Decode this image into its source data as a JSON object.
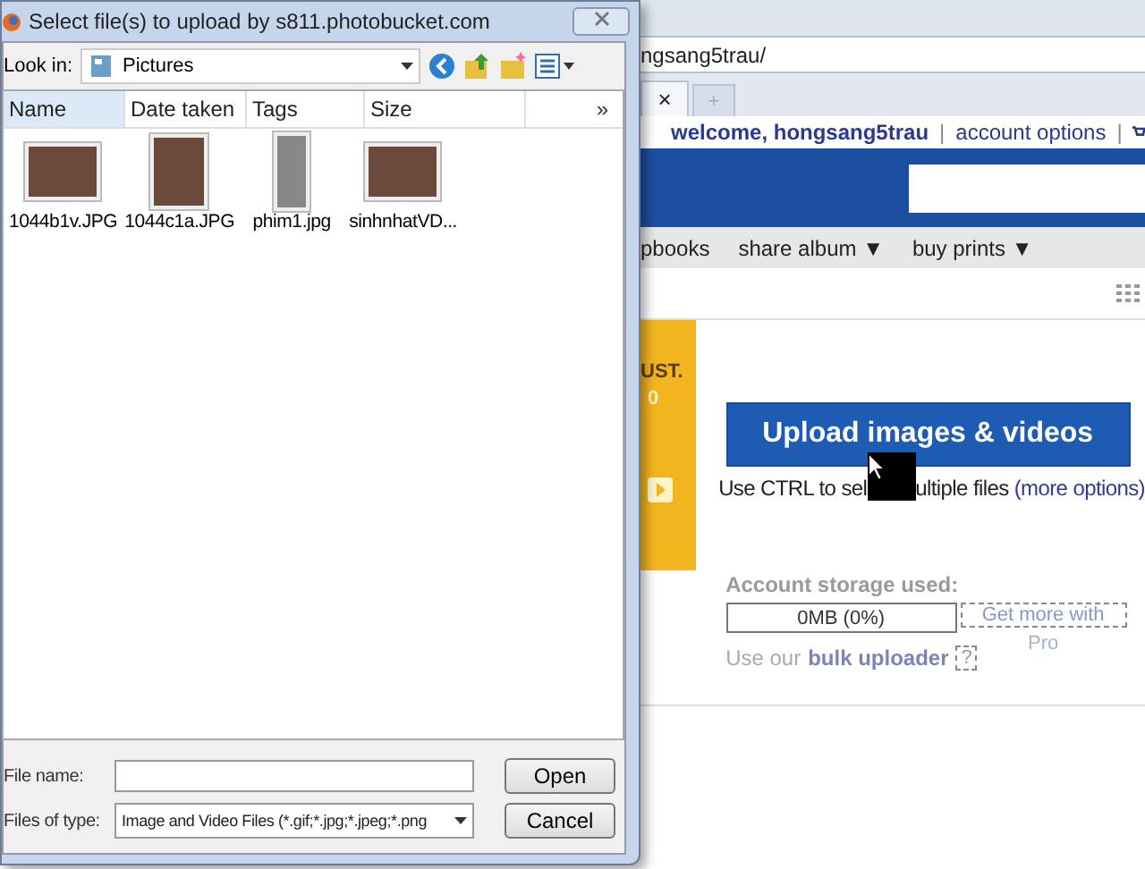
{
  "dialog": {
    "title": "Select file(s) to upload by s811.photobucket.com",
    "look_in": {
      "label": "Look in:",
      "value": "Pictures"
    },
    "columns": [
      {
        "label": "Name",
        "selected": true
      },
      {
        "label": "Date taken",
        "selected": false
      },
      {
        "label": "Tags",
        "selected": false
      },
      {
        "label": "Size",
        "selected": false
      }
    ],
    "more_columns": "»",
    "files": [
      {
        "name": "1044b1v.JPG",
        "kind": "landscape"
      },
      {
        "name": "1044c1a.JPG",
        "kind": "portrait"
      },
      {
        "name": "phim1.jpg",
        "kind": "film"
      },
      {
        "name": "sinhnhatVD...",
        "kind": "landscape"
      }
    ],
    "file_name": {
      "label": "File name:"
    },
    "file_type": {
      "label": "Files of type:",
      "value": "Image and Video Files (*.gif;*.jpg;*.jpeg;*.png"
    },
    "buttons": [
      "Open",
      "Cancel"
    ]
  },
  "browser": {
    "address": "ngsang5trau/",
    "tab_close": "×",
    "new_tab": "+",
    "welcome": "welcome, hongsang5trau",
    "separator": "|",
    "account_link": "account options",
    "nav": [
      {
        "label": "pbooks"
      },
      {
        "label": "share album",
        "caret": "▼"
      },
      {
        "label": "buy prints",
        "caret": "▼"
      }
    ],
    "promo": {
      "line_1": "UST.",
      "line_2": "0"
    },
    "upload_button": "Upload images & videos",
    "hint": {
      "before": "Use CTRL to sel",
      "after": "ultiple files",
      "link": "(more options)"
    },
    "storage": {
      "label": "Account storage used:",
      "reading": "0MB (0%)",
      "level": 0,
      "upgrade_line_1": "Get more with",
      "upgrade_line_2": "Pro"
    },
    "bulk": {
      "text": "Use our",
      "link": "bulk uploader",
      "help": "?"
    }
  }
}
